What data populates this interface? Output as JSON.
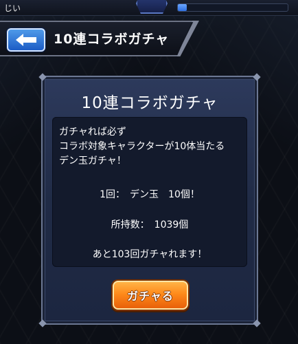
{
  "status_bar": {
    "user_label": "じい",
    "meter_fill": 0.08
  },
  "header": {
    "title": "10連コラボガチャ",
    "back_icon": "back-arrow-icon"
  },
  "dialog": {
    "title": "10連コラボガチャ",
    "message_lines": [
      "ガチャれば必ず",
      "コラボ対象キャラクターが10体当たる",
      "デン玉ガチャ！"
    ],
    "cost_line": "1回：　デン玉　10個！",
    "held_line": "所持数：　1039個",
    "remaining_line": "あと103回ガチャれます！",
    "gacha_button_label": "ガチャる"
  },
  "colors": {
    "button_orange": "#ff8a1a",
    "back_blue": "#2e6fe0",
    "dialog_bg": "#232e4a"
  }
}
